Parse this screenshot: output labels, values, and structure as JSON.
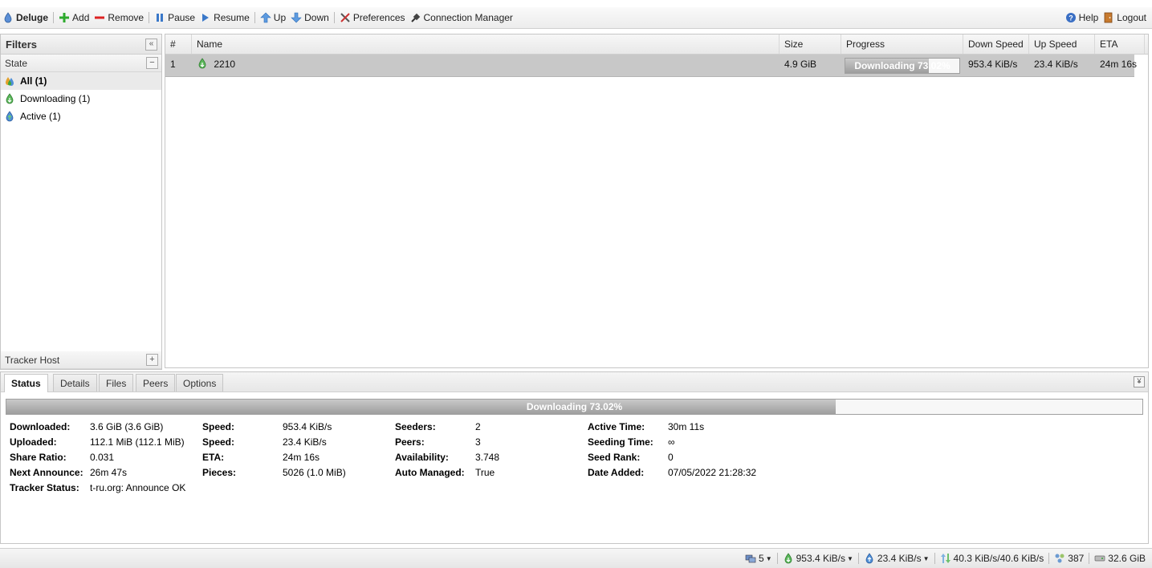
{
  "app": {
    "title": "Deluge"
  },
  "toolbar": {
    "add": "Add",
    "remove": "Remove",
    "pause": "Pause",
    "resume": "Resume",
    "up": "Up",
    "down": "Down",
    "preferences": "Preferences",
    "connection_manager": "Connection Manager",
    "help": "Help",
    "logout": "Logout"
  },
  "filters": {
    "title": "Filters",
    "state_header": "State",
    "items": [
      {
        "label": "All (1)",
        "icon": "all-states-icon",
        "selected": true
      },
      {
        "label": "Downloading (1)",
        "icon": "downloading-icon",
        "selected": false
      },
      {
        "label": "Active (1)",
        "icon": "active-icon",
        "selected": false
      }
    ],
    "tracker_header": "Tracker Host"
  },
  "grid": {
    "columns": [
      "#",
      "Name",
      "Size",
      "Progress",
      "Down Speed",
      "Up Speed",
      "ETA"
    ],
    "rows": [
      {
        "num": "1",
        "name": "2210",
        "size": "4.9 GiB",
        "progress": 0.7302,
        "progress_text": "Downloading 73.02%",
        "down": "953.4 KiB/s",
        "up": "23.4 KiB/s",
        "eta": "24m 16s"
      }
    ]
  },
  "details": {
    "tabs": [
      "Status",
      "Details",
      "Files",
      "Peers",
      "Options"
    ],
    "active_tab": "Status",
    "progress": 0.7302,
    "progress_text": "Downloading 73.02%",
    "col1": [
      {
        "k": "Downloaded:",
        "v": "3.6 GiB (3.6 GiB)"
      },
      {
        "k": "Uploaded:",
        "v": "112.1 MiB (112.1 MiB)"
      },
      {
        "k": "Share Ratio:",
        "v": "0.031"
      },
      {
        "k": "Next Announce:",
        "v": "26m 47s"
      },
      {
        "k": "Tracker Status:",
        "v": "t-ru.org: Announce OK"
      }
    ],
    "col2": [
      {
        "k": "Speed:",
        "v": "953.4 KiB/s"
      },
      {
        "k": "Speed:",
        "v": "23.4 KiB/s"
      },
      {
        "k": "ETA:",
        "v": "24m 16s"
      },
      {
        "k": "Pieces:",
        "v": "5026 (1.0 MiB)"
      }
    ],
    "col3": [
      {
        "k": "Seeders:",
        "v": "2"
      },
      {
        "k": "Peers:",
        "v": "3"
      },
      {
        "k": "Availability:",
        "v": "3.748"
      },
      {
        "k": "Auto Managed:",
        "v": "True"
      }
    ],
    "col4": [
      {
        "k": "Active Time:",
        "v": "30m 11s"
      },
      {
        "k": "Seeding Time:",
        "v": "∞"
      },
      {
        "k": "Seed Rank:",
        "v": "0"
      },
      {
        "k": "Date Added:",
        "v": "07/05/2022 21:28:32"
      }
    ]
  },
  "statusbar": {
    "connections": "5",
    "down_speed": "953.4 KiB/s",
    "up_speed": "23.4 KiB/s",
    "traffic": "40.3 KiB/s/40.6 KiB/s",
    "dht_nodes": "387",
    "free_space": "32.6 GiB"
  },
  "colors": {
    "progress_fill": "#a8a8a8",
    "add_green": "#2eaa2e",
    "remove_red": "#d22",
    "arrow_blue": "#2f74c8"
  }
}
